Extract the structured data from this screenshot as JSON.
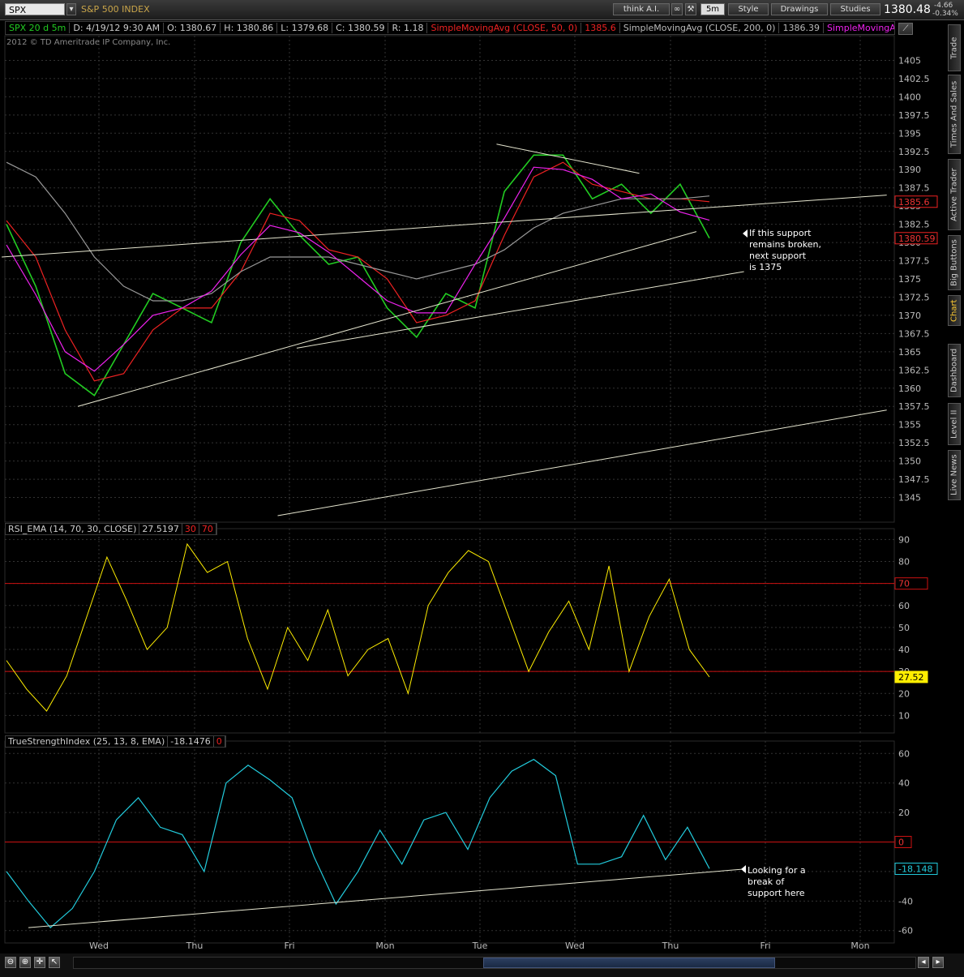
{
  "toolbar": {
    "symbol": "SPX",
    "symbol_name": "S&P 500 INDEX",
    "think_ai": "think A.I.",
    "interval": "5m",
    "style": "Style",
    "drawings": "Drawings",
    "studies": "Studies",
    "last_price": "1380.48",
    "change": "-4.66",
    "change_pct": "-0.34%"
  },
  "study_bar": {
    "symbol_label": "SPX 20 d 5m",
    "date": "D: 4/19/12 9:30 AM",
    "open": "O: 1380.67",
    "high": "H: 1380.86",
    "low": "L: 1379.68",
    "close": "C: 1380.59",
    "range": "R: 1.18",
    "sma50_label": "SimpleMovingAvg (CLOSE, 50, 0)",
    "sma50_value": "1385.6",
    "sma200_label": "SimpleMovingAvg (CLOSE, 200, 0)",
    "sma200_value": "1386.39",
    "sma_extra_label": "SimpleMovingAvg (..."
  },
  "copyright": "2012 © TD Ameritrade IP Company, Inc.",
  "side_tabs": [
    "Trade",
    "Times And Sales",
    "Active Trader",
    "Big Buttons",
    "Chart",
    "Dashboard",
    "Level II",
    "Live News"
  ],
  "colors": {
    "price": "#22cc22",
    "sma50": "#ee2222",
    "sma200": "#999999",
    "sma_magenta": "#ee22ee",
    "rsi": "#ffee00",
    "tsi": "#22ccdd",
    "band": "#cc1111",
    "trendline": "#e6e6d0",
    "grid": "#333333"
  },
  "annotations": {
    "price_note": "If this support\nremains broken,\nnext support\nis 1375",
    "tsi_note": "Looking for a\nbreak of\nsupport here"
  },
  "chart_data": [
    {
      "type": "line",
      "title": "SPX 20 d 5m",
      "xlabel": "",
      "ylabel": "",
      "ylim": [
        1342.5,
        1407.5
      ],
      "yticks": [
        1345,
        1347.5,
        1350,
        1352.5,
        1355,
        1357.5,
        1360,
        1362.5,
        1365,
        1367.5,
        1370,
        1372.5,
        1375,
        1377.5,
        1380,
        1382.5,
        1385,
        1387.5,
        1390,
        1392.5,
        1395,
        1397.5,
        1400,
        1402.5,
        1405
      ],
      "xticks": [
        "Wed",
        "Thu",
        "Fri",
        "Mon",
        "Tue",
        "Wed",
        "Thu",
        "Fri",
        "Mon"
      ],
      "x_session": [
        0,
        0.4,
        0.8,
        1.2,
        1.6,
        2.0,
        2.4,
        2.8,
        3.2,
        3.6,
        4.0,
        4.4,
        4.8,
        5.2,
        5.6,
        6.0,
        6.4,
        6.8,
        7.2
      ],
      "series": [
        {
          "name": "SPX",
          "values": [
            1382.5,
            1374,
            1362,
            1359,
            1366,
            1373,
            1371,
            1369,
            1380,
            1386,
            1381,
            1377,
            1378,
            1371,
            1367,
            1373,
            1371,
            1387,
            1392,
            1392,
            1386,
            1388,
            1384,
            1388,
            1380.59
          ]
        },
        {
          "name": "SimpleMovingAvg (CLOSE, 50, 0)",
          "values": [
            1383,
            1378,
            1368,
            1361,
            1362,
            1368,
            1371,
            1371,
            1376,
            1384,
            1383,
            1379,
            1378,
            1375,
            1369,
            1370,
            1372,
            1381,
            1389,
            1391,
            1388,
            1387,
            1386,
            1386,
            1385.6
          ]
        },
        {
          "name": "SimpleMovingAvg (CLOSE, 200, 0)",
          "values": [
            1391,
            1389,
            1384,
            1378,
            1374,
            1372,
            1372,
            1373,
            1376,
            1378,
            1378,
            1378,
            1377,
            1376,
            1375,
            1376,
            1377,
            1379,
            1382,
            1384,
            1385,
            1386,
            1386,
            1386,
            1386.39
          ]
        }
      ],
      "price_labels": [
        "1385.6",
        "1380.59"
      ],
      "trendlines_note": "support / resistance lines"
    },
    {
      "type": "line",
      "title": "RSI_EMA (14, 70, 30, CLOSE)",
      "value": "27.5197",
      "levels": [
        30,
        70
      ],
      "ylim": [
        5,
        92
      ],
      "yticks": [
        10,
        20,
        30,
        40,
        50,
        60,
        70,
        80,
        90
      ],
      "level_labels": [
        "70",
        "27.52"
      ],
      "series": [
        {
          "name": "RSI_EMA",
          "values": [
            35,
            22,
            12,
            28,
            55,
            82,
            62,
            40,
            50,
            88,
            75,
            80,
            45,
            22,
            50,
            35,
            58,
            28,
            40,
            45,
            20,
            60,
            75,
            85,
            80,
            55,
            30,
            48,
            62,
            40,
            78,
            30,
            55,
            72,
            40,
            27.5
          ]
        }
      ]
    },
    {
      "type": "line",
      "title": "TrueStrengthIndex (25, 13, 8, EMA)",
      "value": "-18.1476",
      "levels": [
        0
      ],
      "ylim": [
        -64,
        64
      ],
      "yticks": [
        -60,
        -40,
        -20,
        0,
        20,
        40,
        60
      ],
      "level_labels": [
        "0",
        "-18.148"
      ],
      "series": [
        {
          "name": "TSI",
          "values": [
            -20,
            -40,
            -58,
            -45,
            -20,
            15,
            30,
            10,
            5,
            -20,
            40,
            52,
            42,
            30,
            -10,
            -42,
            -20,
            8,
            -15,
            15,
            20,
            -5,
            30,
            48,
            56,
            45,
            -15,
            -15,
            -10,
            18,
            -12,
            10,
            -18
          ]
        }
      ]
    }
  ]
}
